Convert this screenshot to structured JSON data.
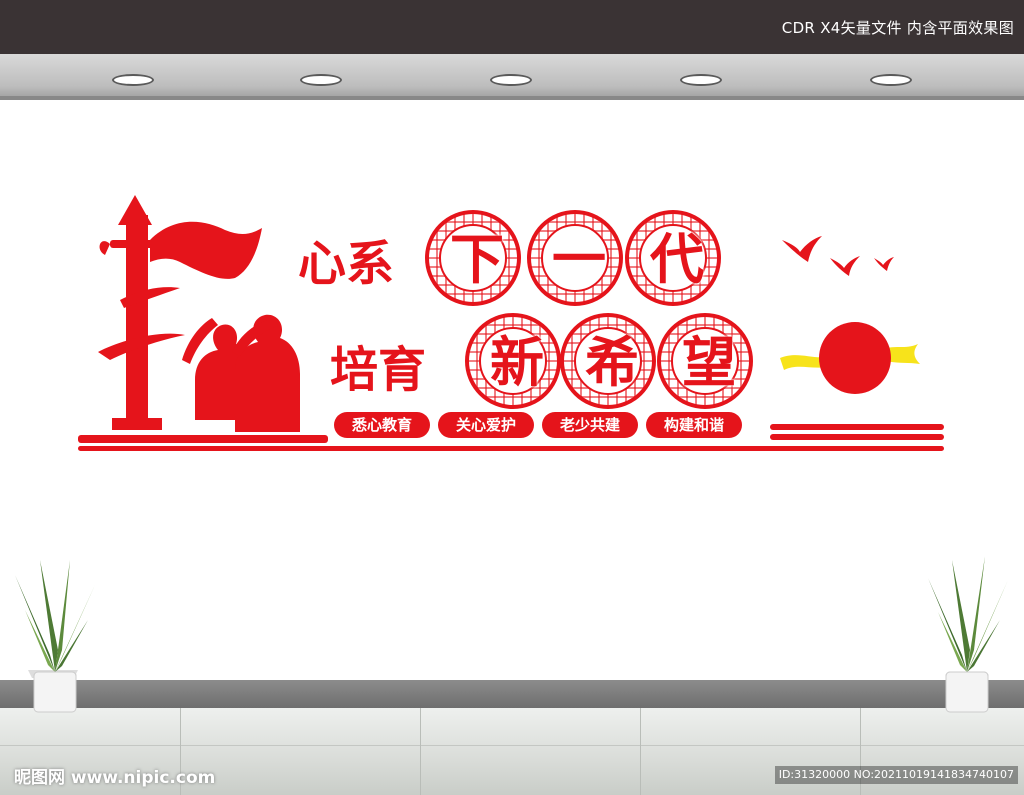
{
  "header": {
    "text": "CDR X4矢量文件  内含平面效果图"
  },
  "signboard": {
    "line1_prefix": "心系",
    "line1_circles": [
      "下",
      "一",
      "代"
    ],
    "line2_prefix": "培育",
    "line2_circles": [
      "新",
      "希",
      "望"
    ],
    "slogans": [
      "悉心教育",
      "关心爱护",
      "老少共建",
      "构建和谐"
    ]
  },
  "watermark": {
    "left": "昵图网 www.nipic.com",
    "right": "ID:31320000 NO:20211019141834740107"
  },
  "colors": {
    "accent": "#e5141b",
    "ribbon": "#f7e31b",
    "wall": "#ffffff",
    "topbar": "#3a3334"
  }
}
